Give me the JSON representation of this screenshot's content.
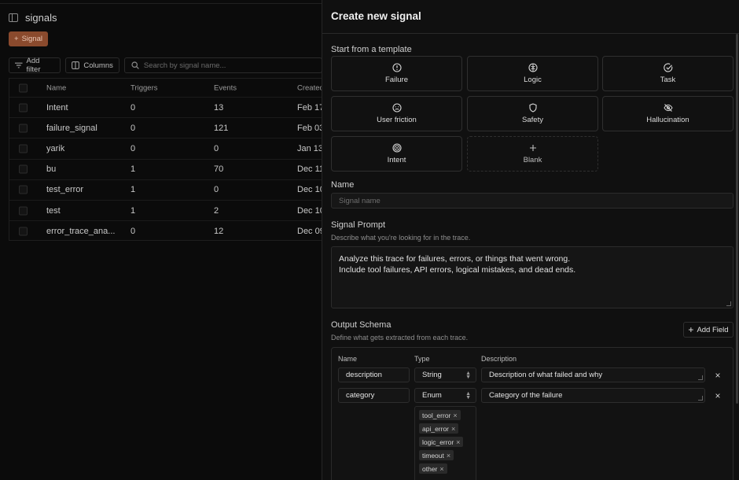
{
  "app": {
    "title": "signals",
    "new_signal_label": "Signal",
    "add_filter_label": "Add filter",
    "columns_label": "Columns",
    "search_placeholder": "Search by signal name...",
    "table": {
      "headers": [
        "Name",
        "Triggers",
        "Events",
        "Created"
      ],
      "rows": [
        {
          "name": "Intent",
          "triggers": "0",
          "events": "13",
          "created": "Feb 17,"
        },
        {
          "name": "failure_signal",
          "triggers": "0",
          "events": "121",
          "created": "Feb 03"
        },
        {
          "name": "yarik",
          "triggers": "0",
          "events": "0",
          "created": "Jan 13,"
        },
        {
          "name": "bu",
          "triggers": "1",
          "events": "70",
          "created": "Dec 11,"
        },
        {
          "name": "test_error",
          "triggers": "1",
          "events": "0",
          "created": "Dec 10"
        },
        {
          "name": "test",
          "triggers": "1",
          "events": "2",
          "created": "Dec 10"
        },
        {
          "name": "error_trace_ana...",
          "triggers": "0",
          "events": "12",
          "created": "Dec 09"
        }
      ]
    }
  },
  "panel": {
    "title": "Create new signal",
    "template_section_label": "Start from a template",
    "templates": [
      {
        "label": "Failure",
        "icon": "alert-circle-icon"
      },
      {
        "label": "Logic",
        "icon": "brain-icon"
      },
      {
        "label": "Task",
        "icon": "check-circle-icon"
      },
      {
        "label": "User friction",
        "icon": "frown-icon"
      },
      {
        "label": "Safety",
        "icon": "shield-icon"
      },
      {
        "label": "Hallucination",
        "icon": "eye-off-icon"
      },
      {
        "label": "Intent",
        "icon": "target-icon"
      },
      {
        "label": "Blank",
        "icon": "plus-icon"
      }
    ],
    "name_label": "Name",
    "name_placeholder": "Signal name",
    "prompt_label": "Signal Prompt",
    "prompt_sub": "Describe what you're looking for in the trace.",
    "prompt_lines": [
      "Analyze this trace for failures, errors, or things that went wrong.",
      "Include tool failures, API errors, logical mistakes, and dead ends."
    ],
    "schema_label": "Output Schema",
    "schema_sub": "Define what gets extracted from each trace.",
    "add_field_label": "Add Field",
    "schema_headers": {
      "name": "Name",
      "type": "Type",
      "description": "Description"
    },
    "fields": [
      {
        "name": "description",
        "type": "String",
        "description": "Description of what failed and why"
      },
      {
        "name": "category",
        "type": "Enum",
        "description": "Category of the failure"
      }
    ],
    "enum_values": [
      "tool_error",
      "api_error",
      "logic_error",
      "timeout",
      "other"
    ]
  },
  "colors": {
    "accent": "#8a4a2d",
    "background": "#0b0b0b",
    "panel": "#101010"
  }
}
